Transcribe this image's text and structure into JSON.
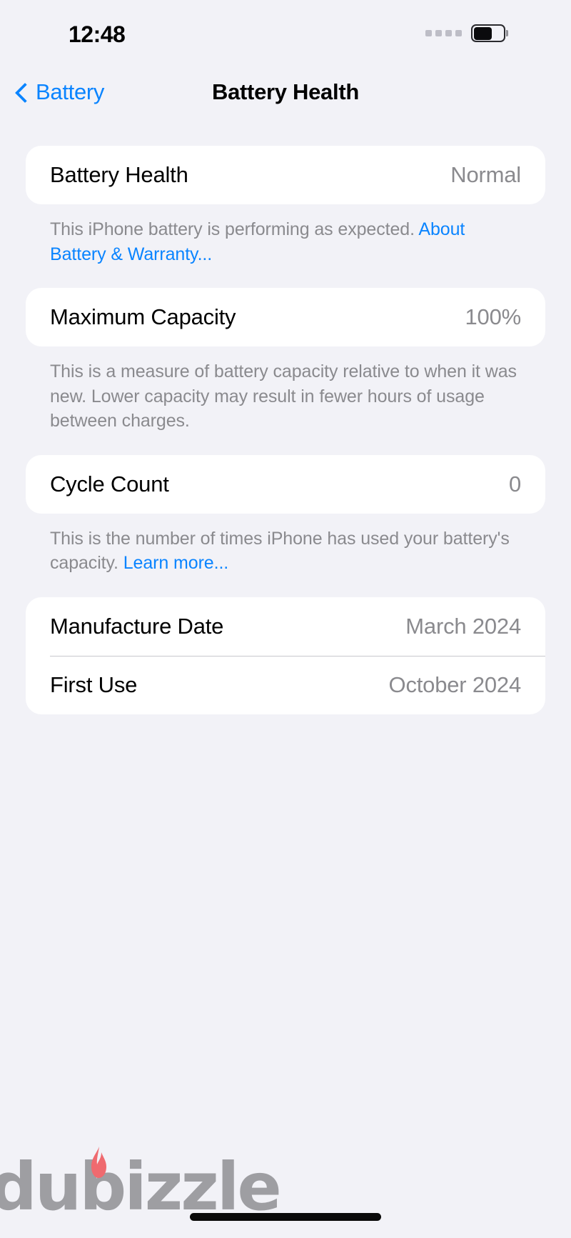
{
  "status_bar": {
    "time": "12:48",
    "signal_dots_count": 4,
    "battery": {
      "icon": "battery-icon",
      "fill_percent": 55
    }
  },
  "nav": {
    "back_icon": "chevron-left-icon",
    "back_label": "Battery",
    "title": "Battery Health"
  },
  "sections": [
    {
      "row": {
        "label": "Battery Health",
        "value": "Normal"
      },
      "footnote": {
        "text": "This iPhone battery is performing as expected. ",
        "link": "About Battery & Warranty..."
      }
    },
    {
      "row": {
        "label": "Maximum Capacity",
        "value": "100%"
      },
      "footnote": {
        "text": "This is a measure of battery capacity relative to when it was new. Lower capacity may result in fewer hours of usage between charges.",
        "link": ""
      }
    },
    {
      "row": {
        "label": "Cycle Count",
        "value": "0"
      },
      "footnote": {
        "text": "This is the number of times iPhone has used your battery's capacity. ",
        "link": "Learn more..."
      }
    }
  ],
  "info_card": {
    "rows": [
      {
        "label": "Manufacture Date",
        "value": "March 2024"
      },
      {
        "label": "First Use",
        "value": "October 2024"
      }
    ]
  },
  "watermark": {
    "text": "dubizzle",
    "flame_icon": "flame-icon"
  },
  "home_indicator": {
    "name": "home-indicator"
  },
  "colors": {
    "background": "#f2f2f7",
    "card": "#ffffff",
    "accent_blue": "#0a84ff",
    "secondary_text": "#8a8a8e",
    "primary_text": "#000000",
    "watermark_gray": "#9a9a9e",
    "flame_red": "#ef6a6f"
  }
}
